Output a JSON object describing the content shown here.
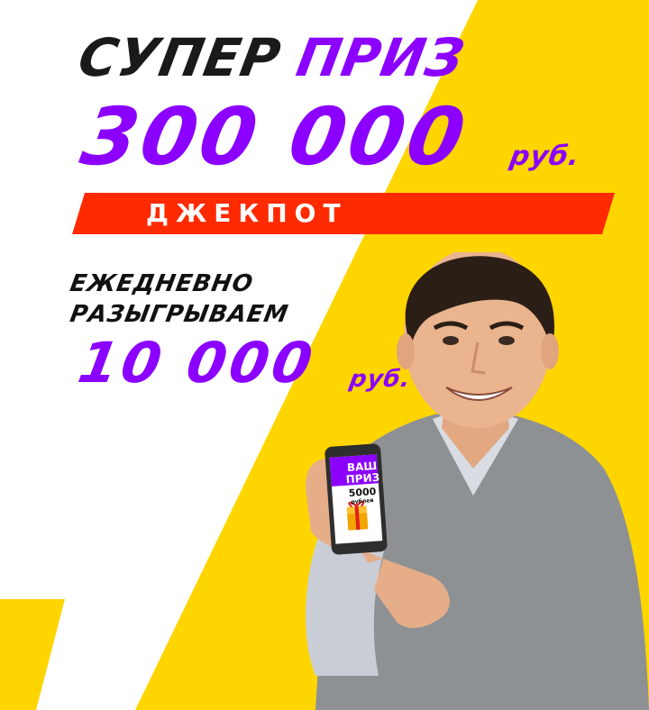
{
  "colors": {
    "yellow": "#FFD500",
    "purple": "#8B00FF",
    "red": "#FF2A00",
    "black": "#1A1A1A",
    "white": "#FFFFFF"
  },
  "headline": {
    "word_black": "СУПЕР",
    "word_purple": "ПРИЗ",
    "amount": "300 000",
    "currency": "руб."
  },
  "jackpot": {
    "label": "ДЖЕКПОТ"
  },
  "daily": {
    "line1": "ЕЖЕДНЕВНО",
    "line2": "РАЗЫГРЫВАЕМ",
    "amount": "10 000",
    "currency": "руб."
  },
  "phone": {
    "prize_line1": "ВАШ",
    "prize_line2": "ПРИЗ",
    "prize_amount": "5000",
    "prize_currency": "рублей"
  },
  "icons": {
    "gift": "gift-icon",
    "phone": "smartphone-icon",
    "person": "person-photo"
  }
}
